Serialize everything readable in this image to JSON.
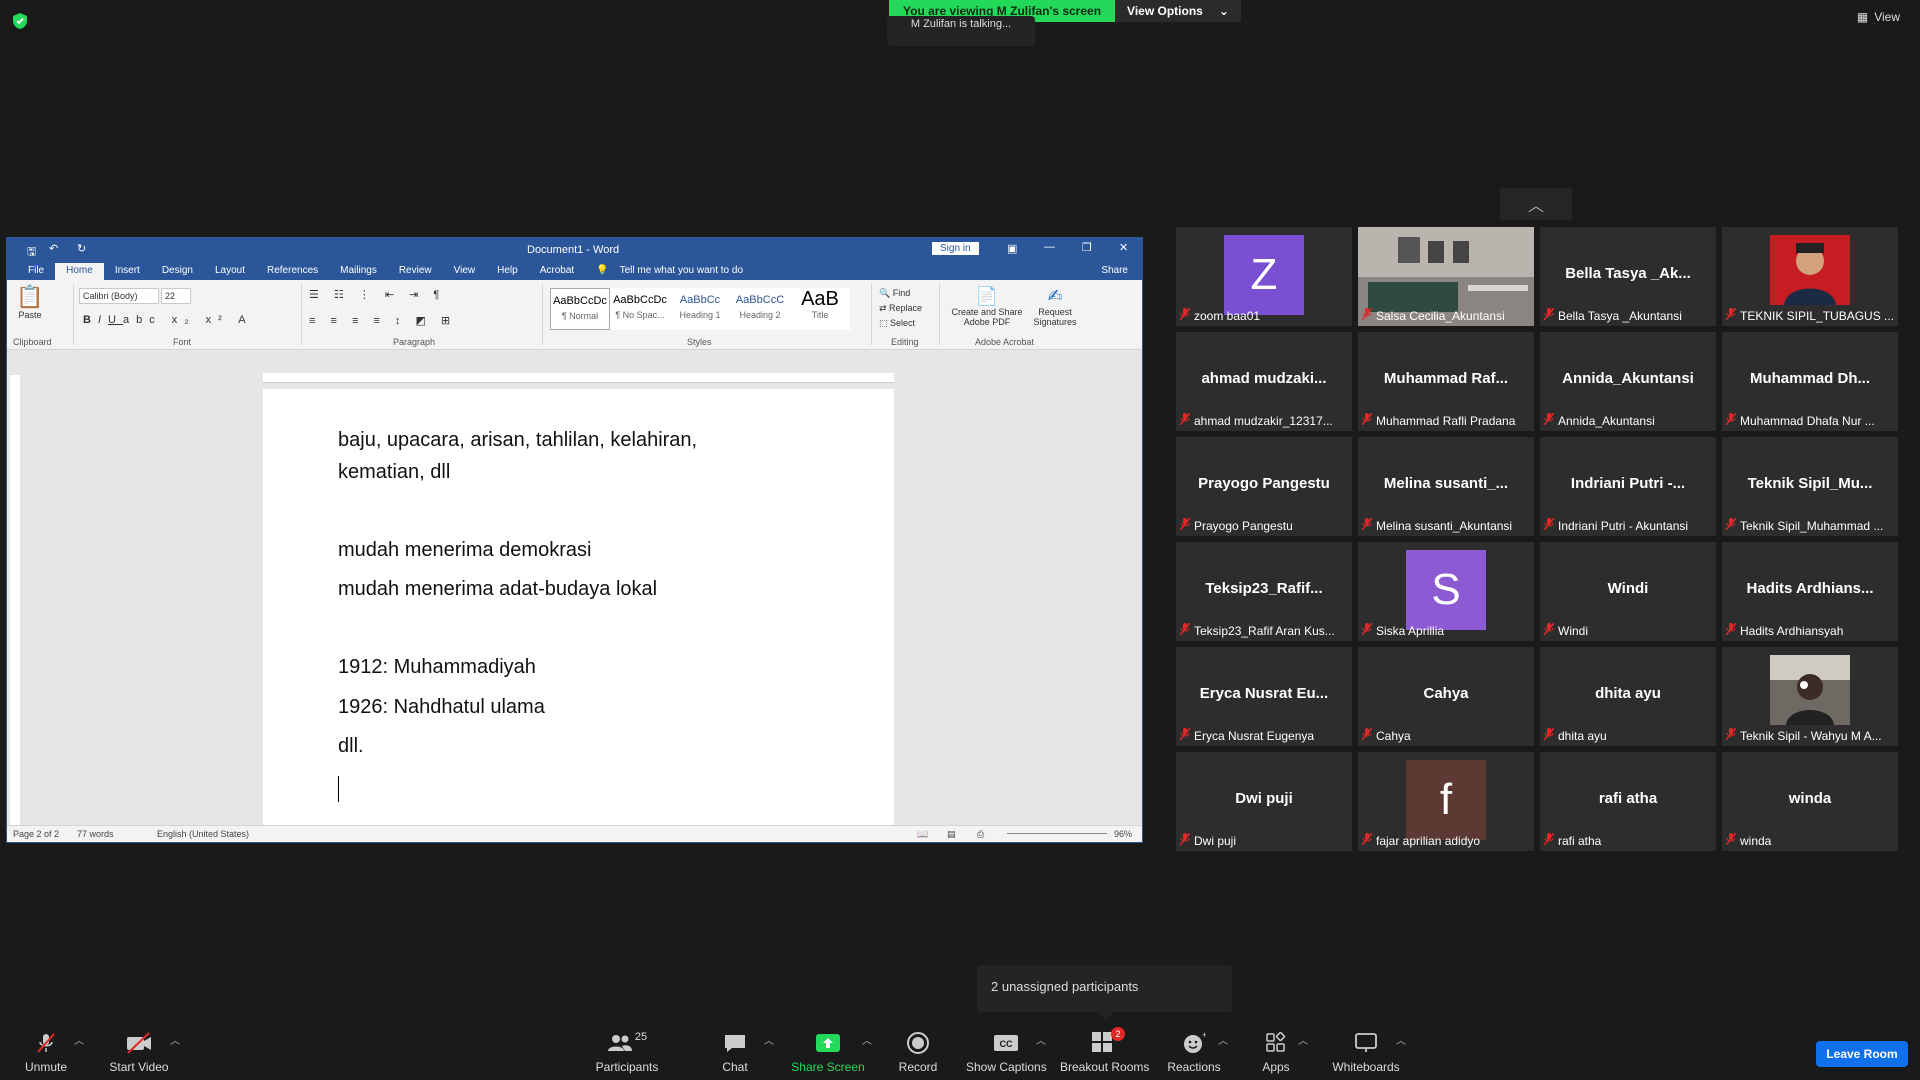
{
  "top": {
    "viewing_text": "You are viewing M Zulifan's screen",
    "view_options": "View Options",
    "talking": "M Zulifan is talking...",
    "view_label": "View"
  },
  "word": {
    "title": "Document1 - Word",
    "sign_in": "Sign in",
    "share": "Share",
    "tell_me": "Tell me what you want to do",
    "tabs": [
      "File",
      "Home",
      "Insert",
      "Design",
      "Layout",
      "References",
      "Mailings",
      "Review",
      "View",
      "Help",
      "Acrobat"
    ],
    "font_name": "Calibri (Body)",
    "font_size": "22",
    "paste": "Paste",
    "groups": {
      "clipboard": "Clipboard",
      "font": "Font",
      "paragraph": "Paragraph",
      "styles": "Styles",
      "editing": "Editing",
      "acrobat": "Adobe Acrobat"
    },
    "styles": [
      {
        "preview": "AaBbCcDc",
        "name": "¶ Normal"
      },
      {
        "preview": "AaBbCcDc",
        "name": "¶ No Spac..."
      },
      {
        "preview": "AaBbCc",
        "name": "Heading 1"
      },
      {
        "preview": "AaBbCcC",
        "name": "Heading 2"
      },
      {
        "preview": "AaB",
        "name": "Title"
      }
    ],
    "editing": {
      "find": "Find",
      "replace": "Replace",
      "select": "Select"
    },
    "acrobat": {
      "create": "Create and Share Adobe PDF",
      "request": "Request Signatures"
    },
    "doc_lines": [
      "baju, upacara, arisan, tahlilan, kelahiran,",
      "kematian, dll",
      "mudah menerima demokrasi",
      "mudah menerima adat-budaya lokal",
      "1912: Muhammadiyah",
      "1926: Nahdhatul ulama",
      "dll."
    ],
    "status": {
      "page": "Page 2 of 2",
      "words": "77 words",
      "lang": "English (United States)",
      "zoom": "96%"
    }
  },
  "participants": [
    {
      "big": "Z",
      "name": "zoom baa01",
      "avatar": "#7b4fd1"
    },
    {
      "big": "",
      "name": "Salsa Cecilia_Akuntansi",
      "photo": "room"
    },
    {
      "big": "Bella  Tasya _Ak...",
      "name": "Bella  Tasya _Akuntansi"
    },
    {
      "big": "",
      "name": "TEKNIK SIPIL_TUBAGUS ...",
      "photo": "person-red"
    },
    {
      "big": "ahmad  mudzaki...",
      "name": "ahmad mudzakir_12317..."
    },
    {
      "big": "Muhammad  Raf...",
      "name": "Muhammad Rafli Pradana"
    },
    {
      "big": "Annida_Akuntansi",
      "name": "Annida_Akuntansi"
    },
    {
      "big": "Muhammad  Dh...",
      "name": "Muhammad Dhafa Nur ..."
    },
    {
      "big": "Prayogo Pangestu",
      "name": "Prayogo Pangestu"
    },
    {
      "big": "Melina  susanti_...",
      "name": "Melina susanti_Akuntansi"
    },
    {
      "big": "Indriani  Putri  -...",
      "name": "Indriani Putri - Akuntansi"
    },
    {
      "big": "Teknik  Sipil_Mu...",
      "name": "Teknik Sipil_Muhammad ..."
    },
    {
      "big": "Teksip23_Rafif...",
      "name": "Teksip23_Rafif Aran Kus..."
    },
    {
      "big": "S",
      "name": "Siska Aprillia",
      "avatar": "#8c5bd4"
    },
    {
      "big": "Windi",
      "name": "Windi"
    },
    {
      "big": "Hadits  Ardhians...",
      "name": "Hadits Ardhiansyah"
    },
    {
      "big": "Eryca  Nusrat  Eu...",
      "name": "Eryca Nusrat Eugenya"
    },
    {
      "big": "Cahya",
      "name": "Cahya"
    },
    {
      "big": "dhita ayu",
      "name": "dhita ayu"
    },
    {
      "big": "",
      "name": "Teknik Sipil - Wahyu M A...",
      "photo": "person-dark"
    },
    {
      "big": "Dwi puji",
      "name": "Dwi puji"
    },
    {
      "big": "f",
      "name": "fajar aprilian adidyo",
      "avatar": "#5c3a33"
    },
    {
      "big": "rafi atha",
      "name": "rafi atha"
    },
    {
      "big": "winda",
      "name": "winda"
    }
  ],
  "toast": "2 unassigned participants",
  "toolbar": {
    "unmute": "Unmute",
    "start_video": "Start Video",
    "participants": "Participants",
    "participants_count": "25",
    "chat": "Chat",
    "share_screen": "Share Screen",
    "record": "Record",
    "captions": "Show Captions",
    "breakout": "Breakout Rooms",
    "breakout_badge": "2",
    "reactions": "Reactions",
    "apps": "Apps",
    "whiteboards": "Whiteboards",
    "leave": "Leave Room"
  }
}
